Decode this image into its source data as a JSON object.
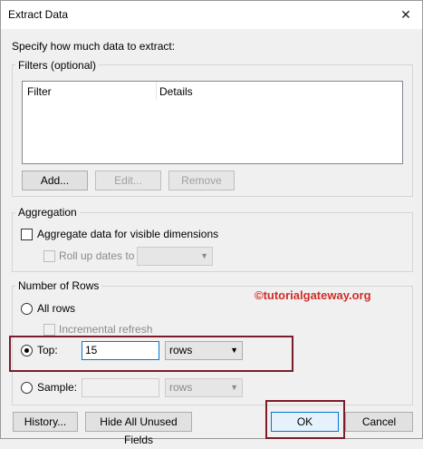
{
  "window": {
    "title": "Extract Data",
    "close_glyph": "✕"
  },
  "prompt": "Specify how much data to extract:",
  "filters": {
    "group_label": "Filters (optional)",
    "columns": [
      "Filter",
      "Details"
    ],
    "buttons": {
      "add": "Add...",
      "edit": "Edit...",
      "remove": "Remove"
    }
  },
  "aggregation": {
    "group_label": "Aggregation",
    "aggregate_label": "Aggregate data for visible dimensions",
    "rollup_label": "Roll up dates to",
    "rollup_value": ""
  },
  "rows": {
    "group_label": "Number of Rows",
    "all_rows_label": "All rows",
    "incremental_label": "Incremental refresh",
    "top_label": "Top:",
    "top_value": "15",
    "top_unit": "rows",
    "sample_label": "Sample:",
    "sample_value": "",
    "sample_unit": "rows"
  },
  "watermark": "©tutorialgateway.org",
  "footer": {
    "history": "History...",
    "hide_unused": "Hide All Unused Fields",
    "ok": "OK",
    "cancel": "Cancel"
  },
  "colors": {
    "highlight": "#7b1c2b",
    "watermark": "#cf2f28",
    "focus": "#0078d7"
  },
  "icons": {
    "dropdown": "▼"
  }
}
